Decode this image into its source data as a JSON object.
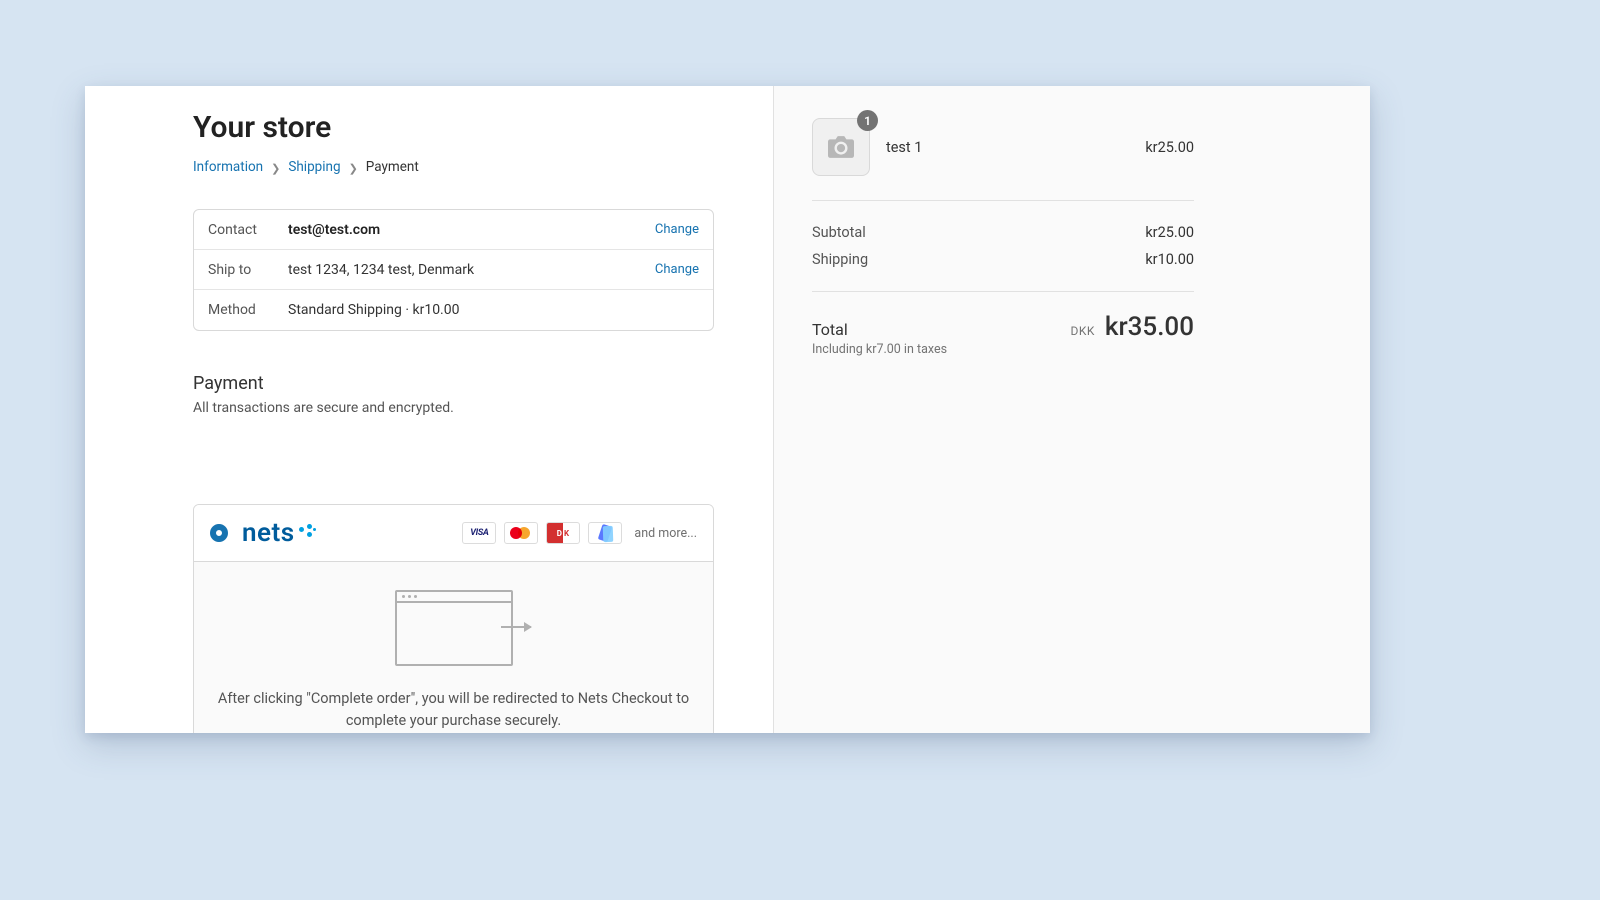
{
  "store_title": "Your store",
  "breadcrumbs": {
    "information": "Information",
    "shipping": "Shipping",
    "payment": "Payment"
  },
  "info": {
    "contact_label": "Contact",
    "contact_value": "test@test.com",
    "shipto_label": "Ship to",
    "shipto_value": "test 1234, 1234 test, Denmark",
    "method_label": "Method",
    "method_value": "Standard Shipping · kr10.00",
    "change": "Change"
  },
  "payment_section": {
    "title": "Payment",
    "subtitle": "All transactions are secure and encrypted."
  },
  "pay_provider": {
    "name": "nets",
    "and_more": "and more...",
    "cards": [
      "visa",
      "mastercard",
      "dankort",
      "mobilepay"
    ],
    "redirect_text": "After clicking \"Complete order\", you will be redirected to Nets Checkout to complete your purchase securely."
  },
  "cart": {
    "product_name": "test 1",
    "product_qty": "1",
    "product_price": "kr25.00",
    "subtotal_label": "Subtotal",
    "subtotal_value": "kr25.00",
    "shipping_label": "Shipping",
    "shipping_value": "kr10.00",
    "total_label": "Total",
    "tax_line": "Including kr7.00 in taxes",
    "currency": "DKK",
    "total_amount": "kr35.00"
  }
}
